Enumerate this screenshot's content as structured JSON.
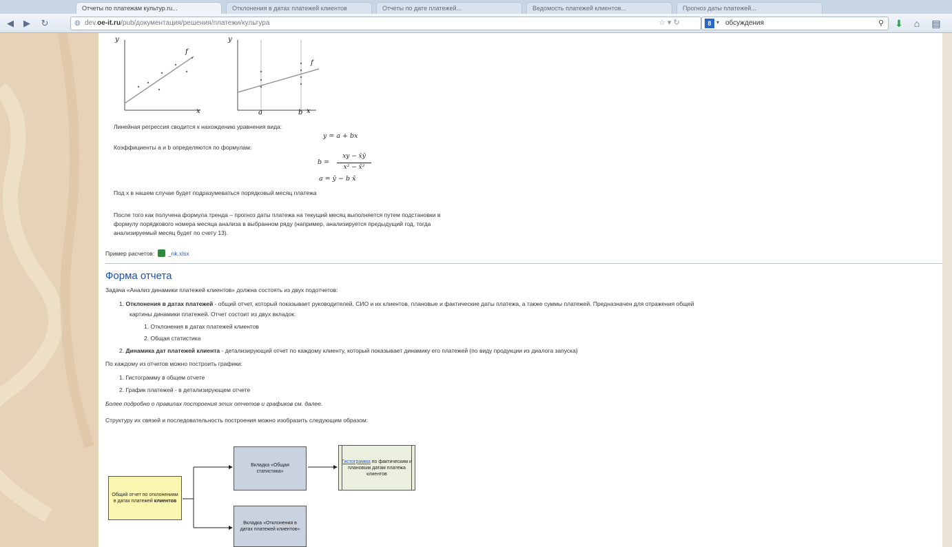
{
  "browser": {
    "tabs": [
      "Отчеты по платежам культур.ru...",
      "Отклонения в датах платежей клиентов",
      "Отчеты по дате платежей...",
      "Ведомость платежей клиентов...",
      "Прогноз даты платежей..."
    ],
    "url_prefix": "dev.",
    "url_site": "oe-it.ru",
    "url_path": "/pub/документация/решения/платежи/культура",
    "search_value": "обсуждения",
    "search_engine_letter": "8"
  },
  "article": {
    "graph_labels": {
      "y1": "y",
      "f1": "f",
      "x1": "x",
      "y2": "y",
      "f2": "f",
      "a": "a",
      "b": "b",
      "x2": "x"
    },
    "regression_intro": "Линейная регрессия сводится к нахождению уравнения вида:",
    "formula_main": "y = a + bx",
    "coef_intro": "Коэффициенты a и b определяются по формулам:",
    "formula_b_lhs": "b =",
    "formula_b_num": "xy − x̄ȳ",
    "formula_b_den": "x² − x̄²",
    "formula_a": "a = ȳ − b x̄",
    "x_note": "Под x в нашем случае будет подразумеваться порядковый месяц платежа",
    "forecast_line1": "После того как получена формула тренда – прогноз даты платежа на текущий месяц выполняется путем подстановки в",
    "forecast_line2": "формулу порядкового номера месяца анализа в выбранном ряду (например, анализируется предыдущий год, тогда",
    "forecast_line3": "анализируемый месяц будет по счету 13).",
    "example_label": "Пример расчетов:",
    "example_file": "_nk.xlsx",
    "section_title": "Форма отчета",
    "task_intro": "Задача «Анализ динамики платежей клиентов» должна состоять из двух подотчетов:",
    "item1_num": "1.",
    "item1_bold": "Отклонения в датах платежей",
    "item1_text": " - общий отчет, который показывает руководителей, СИО и их клиентов, плановые и фактические даты платежа, а также суммы платежей. Предназначен для отражения общей",
    "item1_text2": "картины динамики платежей. Отчет состоит из двух вкладок:",
    "sub1_num": "1.",
    "sub1": "Отклонения в датах платежей клиентов",
    "sub2_num": "2.",
    "sub2": "Общая статистика",
    "item2_num": "2.",
    "item2_bold": "Динамика дат платежей клиента",
    "item2_text": "- детализирующий отчет по каждому клиенту, который показывает динамику его платежей (по виду продукции из диалога запуска)",
    "charts_intro": "По каждому из отчетов можно построить графики:",
    "chart1_num": "1.",
    "chart1": "Гистограмму в общем отчете",
    "chart2_num": "2.",
    "chart2": "График платежей - в детализирующем отчете",
    "more_info": "Более подробно о правилах построения этих отчетов и графиков см. далее.",
    "structure_intro": "Структуру их связей и последовательность построения можно изобразить следующим образом:",
    "diagram": {
      "box_general_pre": "Общий отчет по отклонениям в датах платежей",
      "box_general_bold": "клиентов",
      "box_stats": "Вкладка «Общая статистика»",
      "box_hist_link": "Гистограмма",
      "box_hist_rest": "по фактическим и плановым датам платежа клиентов",
      "box_dev": "Вкладка «Отклонения в датах платежей клиентов»"
    }
  },
  "colors": {
    "heading": "#1a4fae",
    "link": "#3a5bb8",
    "box_yellow": "#fbf7b0",
    "box_blue": "#c9d3e0",
    "box_green": "#eaf0dd"
  }
}
